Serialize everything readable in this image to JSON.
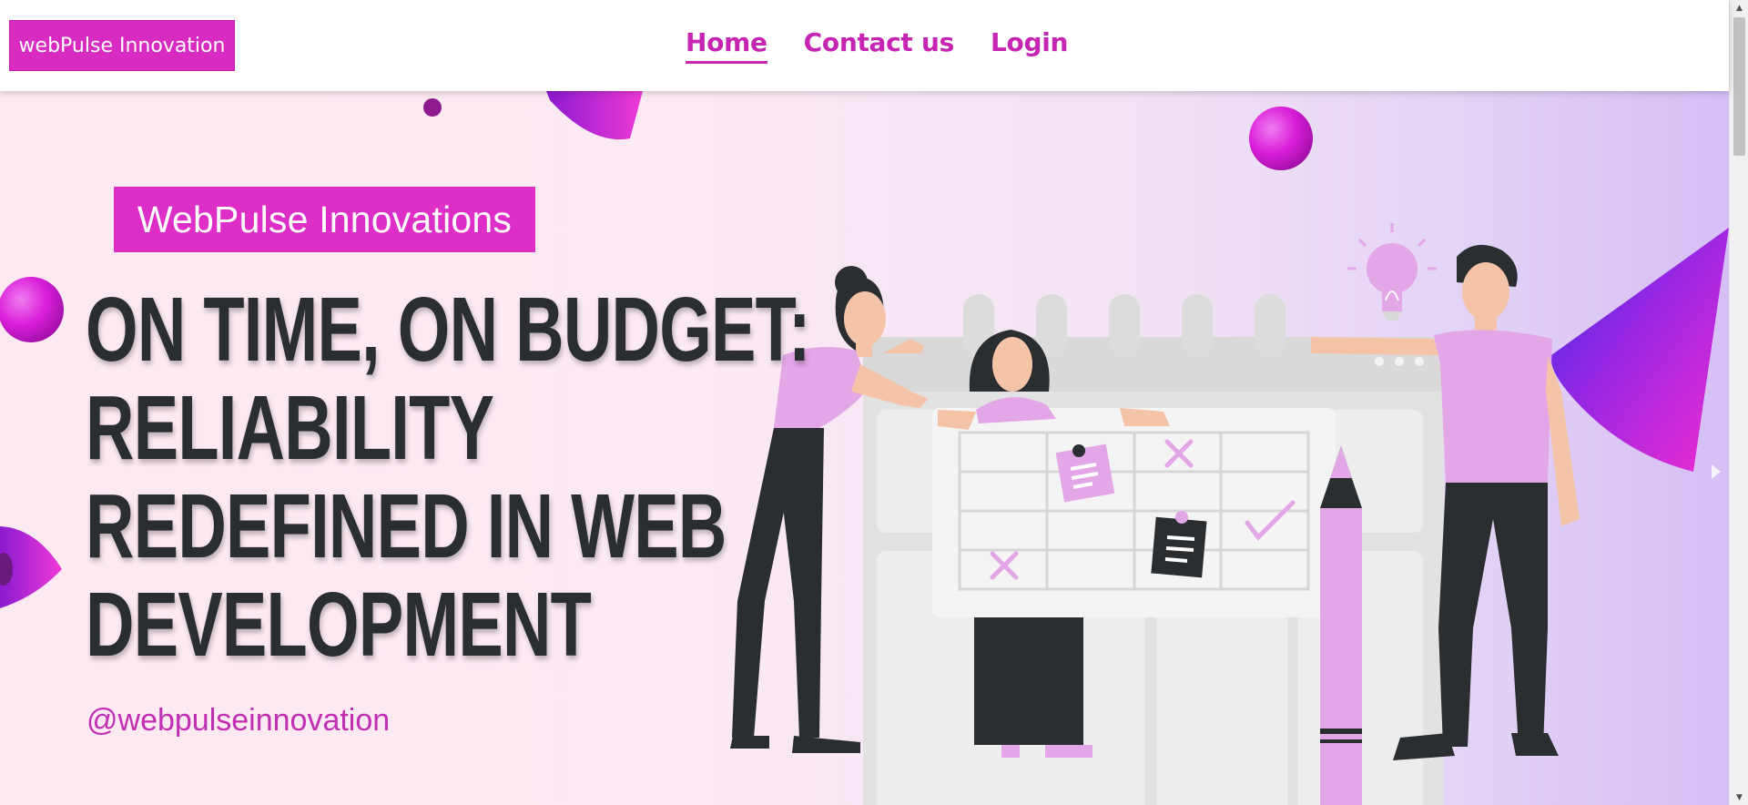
{
  "header": {
    "brand_label": "webPulse Innovation",
    "nav": [
      {
        "label": "Home",
        "active": true
      },
      {
        "label": "Contact us",
        "active": false
      },
      {
        "label": "Login",
        "active": false
      }
    ]
  },
  "hero": {
    "tagline": "WebPulse Innovations",
    "headline_lines": [
      "On Time, On Budget:",
      "Reliability",
      "Redefined in Web",
      "Development"
    ],
    "handle": "@webpulseinnovation"
  },
  "colors": {
    "brand_pink": "#d72bc1",
    "nav_text": "#c525b2",
    "headline_text": "#2b2e31",
    "illustration_lilac": "#e3a6e6",
    "illustration_dark": "#2b2e31"
  },
  "icons": {
    "scroll_up": "up-arrow",
    "scroll_down": "down-arrow",
    "carousel_next": "chevron-right"
  }
}
